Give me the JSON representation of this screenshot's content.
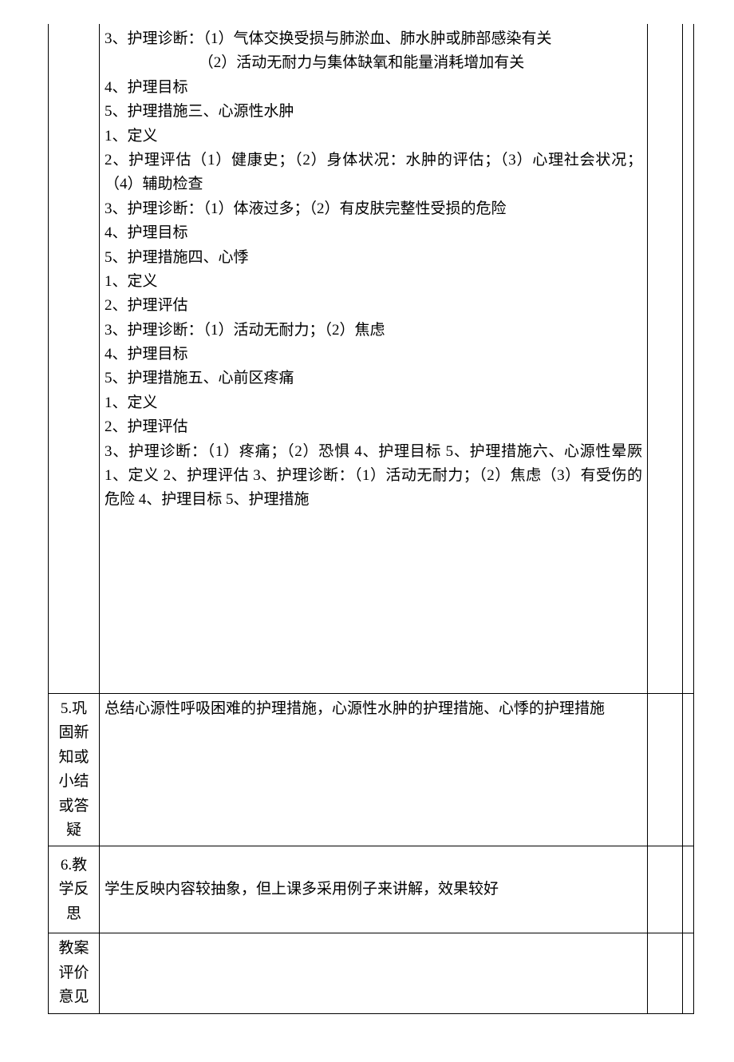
{
  "rows": {
    "content": {
      "lines": [
        "3、护理诊断：（1）气体交换受损与肺淤血、肺水肿或肺部感染有关",
        "（2）活动无耐力与集体缺氧和能量消耗增加有关",
        "4、护理目标",
        "5、护理措施三、心源性水肿",
        "1、定义",
        "2、护理评估（1）健康史；（2）身体状况：水肿的评估；（3）心理社会状况；（4）辅助检查",
        "3、护理诊断：（1）体液过多；（2）有皮肤完整性受损的危险",
        "4、护理目标",
        "5、护理措施四、心悸",
        "1、定义",
        "2、护理评估",
        "3、护理诊断：（1）活动无耐力；（2）焦虑",
        "4、护理目标",
        "5、护理措施五、心前区疼痛",
        "1、定义",
        "2、护理评估",
        "3、护理诊断：（1）疼痛；（2）恐惧 4、护理目标 5、护理措施六、心源性晕厥 1、定义 2、护理评估 3、护理诊断：（1）活动无耐力；（2）焦虑（3）有受伤的危险 4、护理目标 5、护理措施"
      ]
    },
    "consolidate": {
      "label": "5.巩固新知或小结或答疑",
      "text": "总结心源性呼吸困难的护理措施，心源性水肿的护理措施、心悸的护理措施"
    },
    "reflection": {
      "label": "6.教学反思",
      "text": "学生反映内容较抽象，但上课多采用例子来讲解，效果较好"
    },
    "evaluation": {
      "label": "教案评价意见",
      "text": ""
    }
  }
}
